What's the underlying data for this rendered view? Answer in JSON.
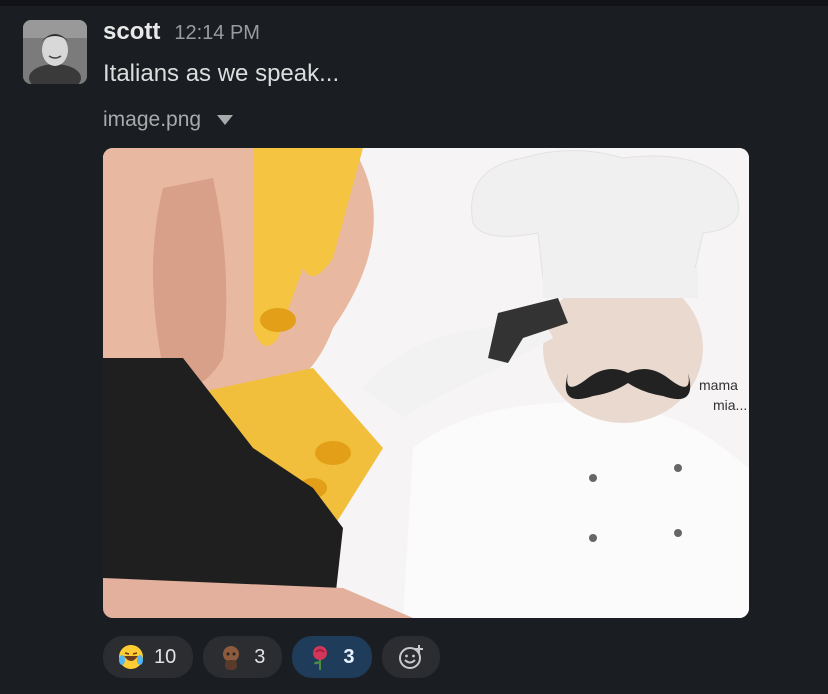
{
  "message": {
    "author": "scott",
    "timestamp": "12:14 PM",
    "text": "Italians as we speak...",
    "attachment": {
      "filename": "image.png",
      "caption": "mama\nmia..."
    }
  },
  "reactions": [
    {
      "emoji": "laughing-crying-emoji",
      "count": "10",
      "active": false
    },
    {
      "emoji": "custom-person-emoji",
      "count": "3",
      "active": false
    },
    {
      "emoji": "rose-emoji",
      "count": "3",
      "active": true
    }
  ],
  "add_reaction": {
    "icon": "add-reaction-icon"
  },
  "colors": {
    "background": "#1a1d21",
    "reaction_bg": "#2b2d31",
    "reaction_active_bg": "#1f3c5a"
  }
}
